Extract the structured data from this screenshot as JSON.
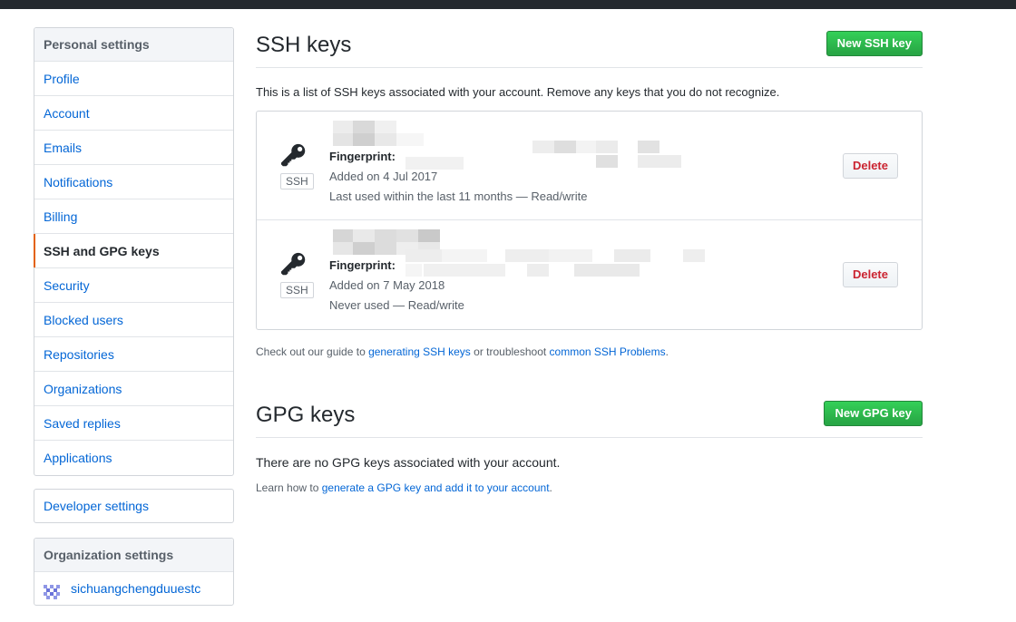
{
  "sidebar": {
    "personal_heading": "Personal settings",
    "items": [
      {
        "label": "Profile"
      },
      {
        "label": "Account"
      },
      {
        "label": "Emails"
      },
      {
        "label": "Notifications"
      },
      {
        "label": "Billing"
      },
      {
        "label": "SSH and GPG keys",
        "selected": true
      },
      {
        "label": "Security"
      },
      {
        "label": "Blocked users"
      },
      {
        "label": "Repositories"
      },
      {
        "label": "Organizations"
      },
      {
        "label": "Saved replies"
      },
      {
        "label": "Applications"
      }
    ],
    "developer_settings": "Developer settings",
    "org_heading": "Organization settings",
    "org_name": "sichuangchengduuestc"
  },
  "ssh": {
    "title": "SSH keys",
    "new_button": "New SSH key",
    "description": "This is a list of SSH keys associated with your account. Remove any keys that you do not recognize.",
    "keys": [
      {
        "fingerprint_label": "Fingerprint:",
        "added": "Added on 4 Jul 2017",
        "last_used": "Last used within the last 11 months — Read/write",
        "type_label": "SSH",
        "delete_label": "Delete"
      },
      {
        "fingerprint_label": "Fingerprint:",
        "added": "Added on 7 May 2018",
        "last_used": "Never used — Read/write",
        "type_label": "SSH",
        "delete_label": "Delete"
      }
    ],
    "guide": {
      "prefix": "Check out our guide to ",
      "link1": "generating SSH keys",
      "middle": " or troubleshoot ",
      "link2": "common SSH Problems",
      "suffix": "."
    }
  },
  "gpg": {
    "title": "GPG keys",
    "new_button": "New GPG key",
    "empty": "There are no GPG keys associated with your account.",
    "learn": {
      "prefix": "Learn how to ",
      "link": "generate a GPG key and add it to your account",
      "suffix": "."
    }
  },
  "colors": {
    "primary_green": "#28a745",
    "link_blue": "#0366d6",
    "danger_red": "#cb2431",
    "selected_accent": "#e36209",
    "topbar": "#24292e"
  },
  "icons": {
    "key": "key-icon",
    "avatar": "org-avatar-icon"
  }
}
